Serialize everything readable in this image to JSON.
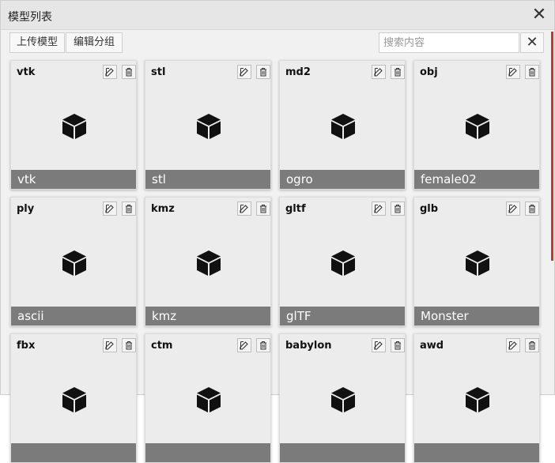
{
  "dialog": {
    "title": "模型列表",
    "close_label": "✕"
  },
  "toolbar": {
    "upload_label": "上传模型",
    "edit_group_label": "编辑分组",
    "search_placeholder": "搜索内容",
    "search_value": "",
    "clear_label": "✕"
  },
  "models": [
    {
      "type": "vtk",
      "name": "vtk"
    },
    {
      "type": "stl",
      "name": "stl"
    },
    {
      "type": "md2",
      "name": "ogro"
    },
    {
      "type": "obj",
      "name": "female02"
    },
    {
      "type": "ply",
      "name": "ascii"
    },
    {
      "type": "kmz",
      "name": "kmz"
    },
    {
      "type": "gltf",
      "name": "glTF"
    },
    {
      "type": "glb",
      "name": "Monster"
    },
    {
      "type": "fbx",
      "name": ""
    },
    {
      "type": "ctm",
      "name": ""
    },
    {
      "type": "babylon",
      "name": ""
    },
    {
      "type": "awd",
      "name": ""
    }
  ],
  "icons": {
    "close": "close-icon",
    "edit": "edit-icon",
    "delete": "trash-icon",
    "model": "cube-icon"
  },
  "colors": {
    "card_label_bg": "#7b7b7b",
    "accent_edge": "#c0392b"
  }
}
